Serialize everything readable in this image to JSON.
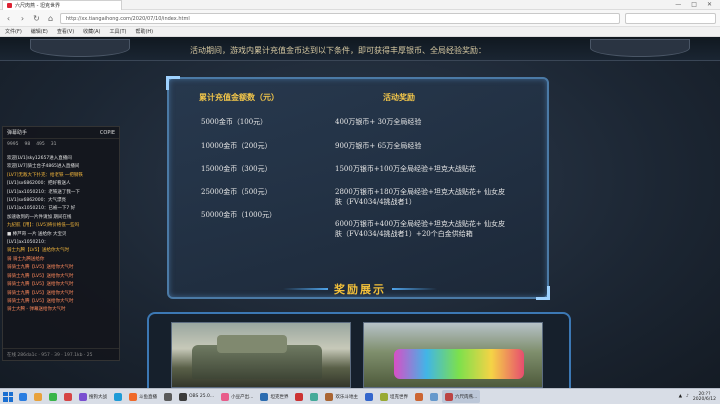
{
  "browser": {
    "tab_title": "六尺肉燕 - 坦克世界",
    "url": "http://xx.tiangaihong.com/2020/07/10/index.html",
    "search_placeholder": "",
    "window_controls": [
      "—",
      "□",
      "✕"
    ],
    "menu": [
      "文件(F)",
      "编辑(E)",
      "查看(V)",
      "收藏(A)",
      "工具(T)",
      "帮助(H)"
    ]
  },
  "page": {
    "intro": "活动期间，游戏内累计充值金币达到以下条件，即可获得丰厚银币、全局经验奖励：",
    "table_headers": [
      "累计充值金额数（元）",
      "活动奖励"
    ],
    "rows": [
      {
        "amount": "5000金币（100元）",
        "reward": [
          "400万银币+ 30万全局经验"
        ]
      },
      {
        "amount": "10000金币（200元）",
        "reward": [
          "900万银币+ 65万全局经验"
        ]
      },
      {
        "amount": "15000金币（300元）",
        "reward": [
          "1500万银币+100万全局经验+坦克大战贴花"
        ]
      },
      {
        "amount": "25000金币（500元）",
        "reward": [
          "2800万银币+180万全局经验+坦克大战贴花+ 仙女皮",
          "肤（FV4034/4挑战者1）"
        ]
      },
      {
        "amount": "50000金币（1000元）",
        "reward": [
          "6000万银币+400万全局经验+坦克大战贴花+ 仙女皮",
          "肤（FV4034/4挑战者1）+20个白金供给箱"
        ]
      }
    ],
    "section_title": "奖励展示"
  },
  "chat": {
    "title": "弹幕助手",
    "count_label": "COPIE",
    "stats": [
      "9995",
      "98",
      "495",
      "31"
    ],
    "lines": [
      {
        "text": "欢迎[LV1]sky12657进入直播间",
        "style": ""
      },
      {
        "text": "欢迎[LV7]骑士台子4865进入直播间",
        "style": ""
      },
      {
        "text": "[LV7]无敌大下扑克：给老铁  一把钢铁",
        "style": "y"
      },
      {
        "text": "[LV1]sx6862000：把好看送人",
        "style": ""
      },
      {
        "text": "[LV1]ax1050210：老铁送了我一下",
        "style": ""
      },
      {
        "text": "[LV1]sx6862000：大气漂亮",
        "style": ""
      },
      {
        "text": "[LV1]ax1050210：已被一下7 好",
        "style": ""
      },
      {
        "text": "加速收到的一片件请加 期间在线",
        "style": ""
      },
      {
        "text": "九纪航【用】：[LV5]将价格低一些吗",
        "style": "y"
      },
      {
        "text": "■ 棒芦哥 一片 送给你 大宝贝",
        "style": ""
      },
      {
        "text": "[LV1]ax1050210：",
        "style": ""
      },
      {
        "text": "骑士九腾【LV5】送给你大气时",
        "style": "y"
      },
      {
        "text": "",
        "style": ""
      },
      {
        "text": "骑 骑士九腾送给你",
        "style": "p"
      },
      {
        "text": "骑骑士九腾【LV5】送给你大气时",
        "style": "p"
      },
      {
        "text": "骑骑士九腾【LV5】送给你大气时",
        "style": "p"
      },
      {
        "text": "骑骑士九腾【LV5】送给你大气时",
        "style": "p"
      },
      {
        "text": "骑骑士九腾【LV5】送给你大气时",
        "style": "p"
      },
      {
        "text": "骑骑士九腾【LV5】送给你大气时",
        "style": "p"
      },
      {
        "text": "骑士大腾 - 弹幕送给你大气时",
        "style": "p"
      }
    ],
    "footer": "在线 286da1c  ·  957  ·  39  ·  197.1kb  ·  25"
  },
  "taskbar": {
    "items": [
      "",
      "",
      "",
      "",
      "搜狗大战",
      "",
      "斗鱼直播",
      "",
      "OBS 25.0...",
      "小豆产出...",
      "坦克世界",
      "",
      "",
      "欢乐斗地主",
      "",
      "坦克世界",
      "",
      "",
      "六尺肉燕..."
    ],
    "time": "20:??",
    "date": "2020/6/12"
  }
}
